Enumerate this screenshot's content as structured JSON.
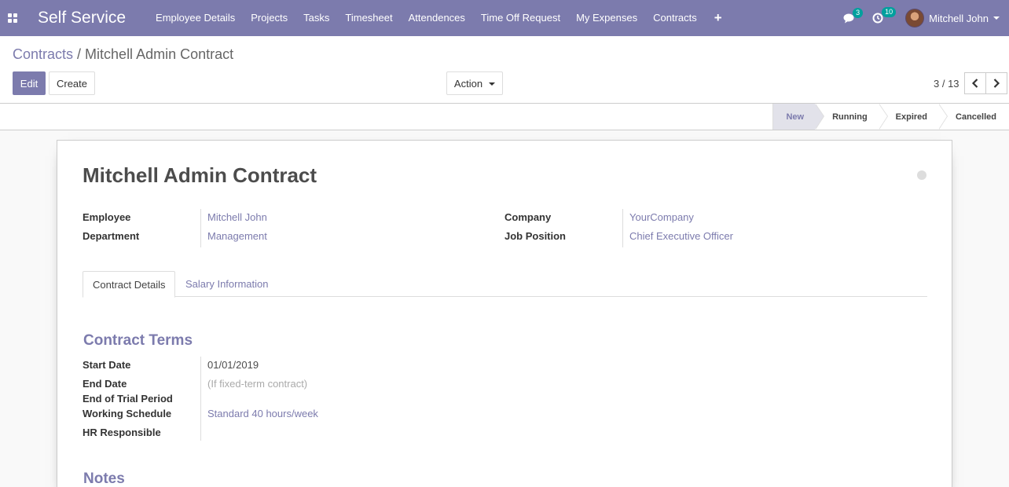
{
  "navbar": {
    "brand": "Self Service",
    "menu": [
      "Employee Details",
      "Projects",
      "Tasks",
      "Timesheet",
      "Attendences",
      "Time Off Request",
      "My Expenses",
      "Contracts"
    ],
    "plus": "+",
    "messages_count": "3",
    "activities_count": "10",
    "user_name": "Mitchell John"
  },
  "breadcrumb": {
    "parent": "Contracts",
    "separator": "/",
    "current": "Mitchell Admin Contract"
  },
  "buttons": {
    "edit": "Edit",
    "create": "Create",
    "action": "Action"
  },
  "pager": {
    "value": "3 / 13"
  },
  "stages": [
    "New",
    "Running",
    "Expired",
    "Cancelled"
  ],
  "form": {
    "title": "Mitchell Admin Contract",
    "employee_label": "Employee",
    "employee": "Mitchell John",
    "department_label": "Department",
    "department": "Management",
    "company_label": "Company",
    "company": "YourCompany",
    "job_label": "Job Position",
    "job": "Chief Executive Officer",
    "tabs": [
      "Contract Details",
      "Salary Information"
    ],
    "section_terms": "Contract Terms",
    "start_label": "Start Date",
    "start": "01/01/2019",
    "end_label": "End Date",
    "end_placeholder": "(If fixed-term contract)",
    "trial_label": "End of Trial Period",
    "schedule_label": "Working Schedule",
    "schedule": "Standard 40 hours/week",
    "hr_label": "HR Responsible",
    "section_notes": "Notes"
  },
  "colors": {
    "brand": "#7c7bad",
    "badge": "#00a09d"
  }
}
